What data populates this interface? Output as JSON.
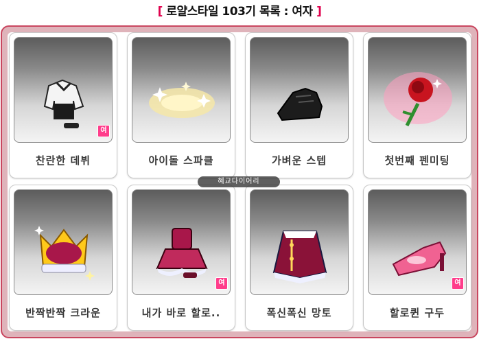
{
  "header": {
    "title": "로얄스타일 103기 목록 : 여자",
    "accent_color": "#e0004d"
  },
  "watermark": "혜교다이어리",
  "items": [
    {
      "name": "찬란한 데뷔",
      "icon": "white-outfit-icon",
      "badge": "여"
    },
    {
      "name": "아이돌 스파클",
      "icon": "sparkle-effect-icon",
      "badge": ""
    },
    {
      "name": "가벼운 스텝",
      "icon": "black-shoes-icon",
      "badge": ""
    },
    {
      "name": "첫번째 펜미팅",
      "icon": "rose-bouquet-icon",
      "badge": ""
    },
    {
      "name": "반짝반짝 크라운",
      "icon": "crown-icon",
      "badge": ""
    },
    {
      "name": "내가 바로 할로..",
      "icon": "pink-dress-icon",
      "badge": "여"
    },
    {
      "name": "폭신폭신 망토",
      "icon": "cape-icon",
      "badge": ""
    },
    {
      "name": "할로퀸 구두",
      "icon": "pink-shoes-icon",
      "badge": "여"
    }
  ],
  "colors": {
    "frame_border": "#c9465f",
    "frame_fill": "#dfb3ba",
    "badge": "#ff3d8b"
  }
}
